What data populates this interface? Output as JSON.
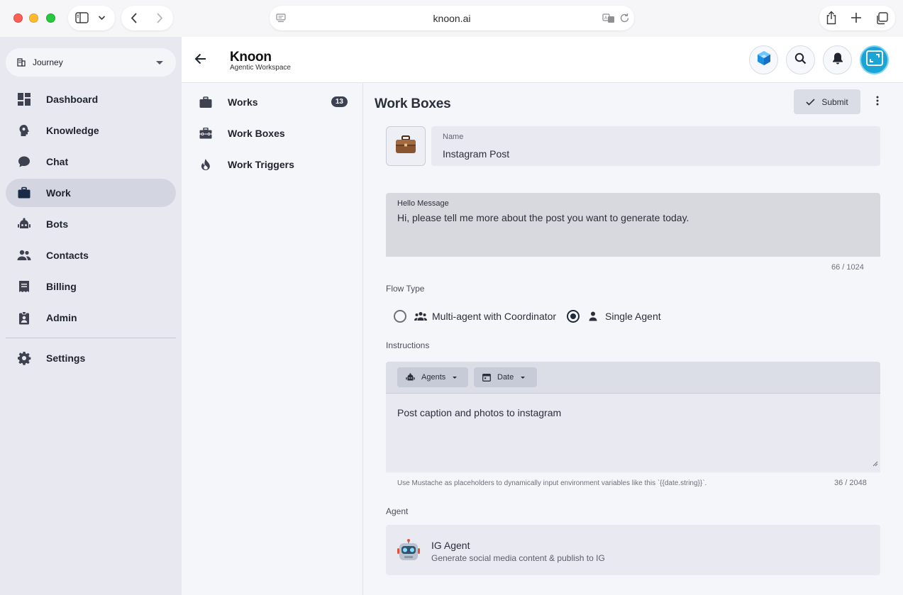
{
  "browser": {
    "url": "knoon.ai"
  },
  "sidebar": {
    "workspace": "Journey",
    "items": [
      {
        "label": "Dashboard",
        "icon": "dashboard-icon"
      },
      {
        "label": "Knowledge",
        "icon": "knowledge-icon"
      },
      {
        "label": "Chat",
        "icon": "chat-icon"
      },
      {
        "label": "Work",
        "icon": "briefcase-icon",
        "active": true
      },
      {
        "label": "Bots",
        "icon": "bot-icon"
      },
      {
        "label": "Contacts",
        "icon": "contacts-icon"
      },
      {
        "label": "Billing",
        "icon": "receipt-icon"
      },
      {
        "label": "Admin",
        "icon": "admin-badge-icon"
      }
    ],
    "settings": "Settings"
  },
  "header": {
    "brand": "Knoon",
    "subtitle": "Agentic Workspace"
  },
  "subnav": {
    "items": [
      {
        "label": "Works",
        "badge": "13"
      },
      {
        "label": "Work Boxes"
      },
      {
        "label": "Work Triggers"
      }
    ]
  },
  "main": {
    "title": "Work Boxes",
    "submit_label": "Submit",
    "name_label": "Name",
    "name_value": "Instagram Post",
    "hello_label": "Hello Message",
    "hello_value": "Hi, please tell me more about the post you want to generate today.",
    "hello_counter": "66 / 1024",
    "flow_label": "Flow Type",
    "flow_options": [
      {
        "label": "Multi-agent with Coordinator",
        "selected": false
      },
      {
        "label": "Single Agent",
        "selected": true
      }
    ],
    "instructions_label": "Instructions",
    "chip_agents": "Agents",
    "chip_date": "Date",
    "instructions_value": "Post caption and photos to instagram",
    "instructions_hint": "Use Mustache as placeholders to dynamically input environment variables like this `{{date.string}}`.",
    "instructions_counter": "36 / 2048",
    "agent_label": "Agent",
    "agent_name": "IG Agent",
    "agent_desc": "Generate social media content & publish to IG"
  },
  "colors": {
    "sidebar_bg": "#e8e9f0",
    "active_item": "#d3d6e0",
    "avatar_accent": "#1ba4d6",
    "badge_bg": "#3b4152"
  }
}
